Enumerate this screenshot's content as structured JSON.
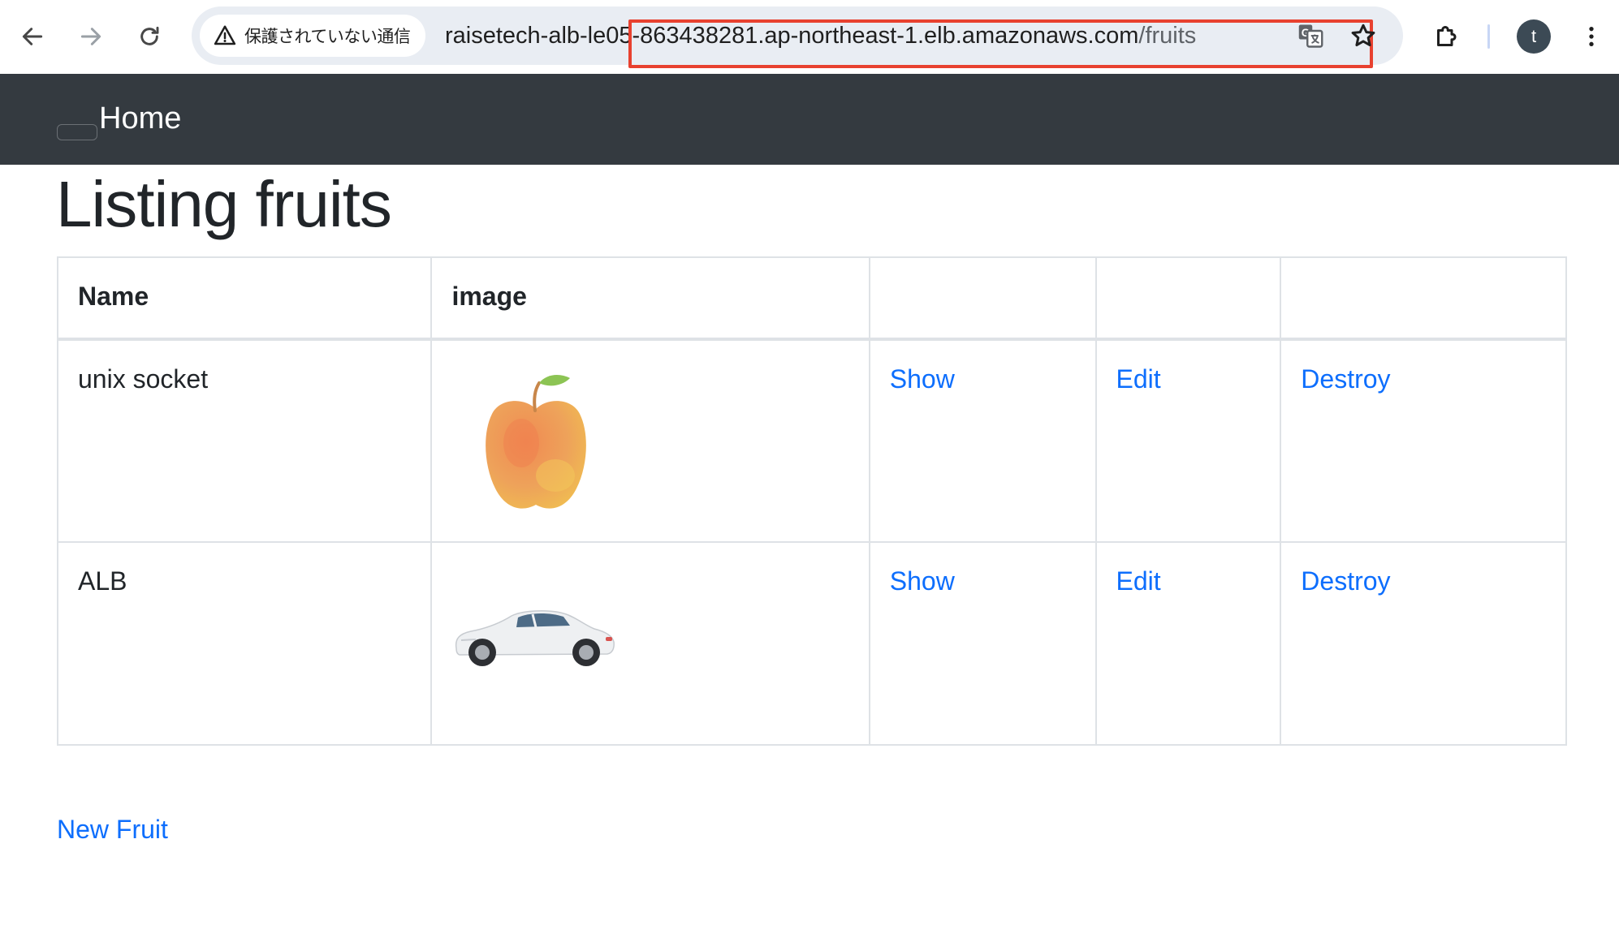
{
  "browser": {
    "security_text": "保護されていない通信",
    "url_host": "raisetech-alb-le05-863438281.ap-northeast-1.elb.amazonaws.com",
    "url_path": "/fruits",
    "avatar_letter": "t",
    "highlight_color": "#e8412f"
  },
  "navbar": {
    "home_label": "Home",
    "background": "#343a40"
  },
  "page": {
    "title": "Listing fruits",
    "new_link": "New Fruit",
    "link_color": "#0d6efd"
  },
  "table": {
    "headers": [
      "Name",
      "image",
      "",
      "",
      ""
    ],
    "rows": [
      {
        "name": "unix socket",
        "image": "apple",
        "show": "Show",
        "edit": "Edit",
        "destroy": "Destroy"
      },
      {
        "name": "ALB",
        "image": "white-car",
        "show": "Show",
        "edit": "Edit",
        "destroy": "Destroy"
      }
    ]
  },
  "icons": {
    "back": "arrow-left-icon",
    "forward": "arrow-right-icon",
    "reload": "reload-icon",
    "warning": "warning-triangle-icon",
    "translate": "translate-icon",
    "bookmark": "star-icon",
    "extensions": "puzzle-icon",
    "menu": "kebab-menu-icon"
  }
}
